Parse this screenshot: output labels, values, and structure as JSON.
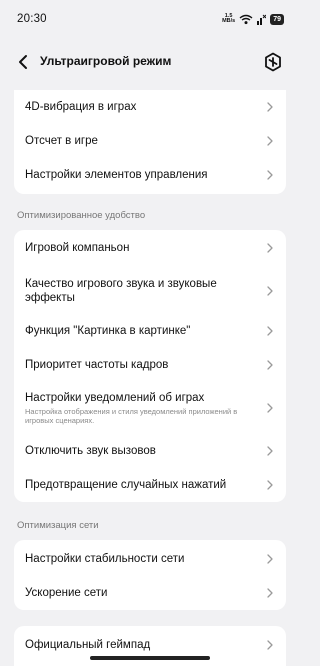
{
  "status_bar": {
    "time": "20:30",
    "net_speed_value": "1.5",
    "net_speed_unit": "MB/s",
    "battery": "79"
  },
  "header": {
    "title": "Ультраигровой режим",
    "back_icon": "chevron-left-icon",
    "action_icon": "game-mode-icon"
  },
  "cards": {
    "top": [
      "4D-вибрация в играх",
      "Отсчет в игре",
      "Настройки элементов управления"
    ],
    "convenience": [
      {
        "label": "Игровой компаньон",
        "desc": ""
      },
      {
        "label": "Качество игрового звука и звуковые эффекты",
        "desc": ""
      },
      {
        "label": "Функция \"Картинка в картинке\"",
        "desc": ""
      },
      {
        "label": "Приоритет частоты кадров",
        "desc": ""
      },
      {
        "label": "Настройки уведомлений об играх",
        "desc": "Настройка отображения и стиля уведомлений приложений в игровых сценариях."
      },
      {
        "label": "Отключить звук вызовов",
        "desc": ""
      },
      {
        "label": "Предотвращение случайных нажатий",
        "desc": ""
      }
    ],
    "network": [
      "Настройки стабильности сети",
      "Ускорение сети"
    ],
    "bottom": [
      "Официальный геймпад"
    ]
  },
  "sections": {
    "convenience": "Оптимизированное удобство",
    "network": "Оптимизация сети"
  },
  "colors": {
    "background": "#f1f1f3",
    "card": "#ffffff",
    "chevron": "#9a9a9a",
    "secondary_text": "#8a8a8a"
  }
}
